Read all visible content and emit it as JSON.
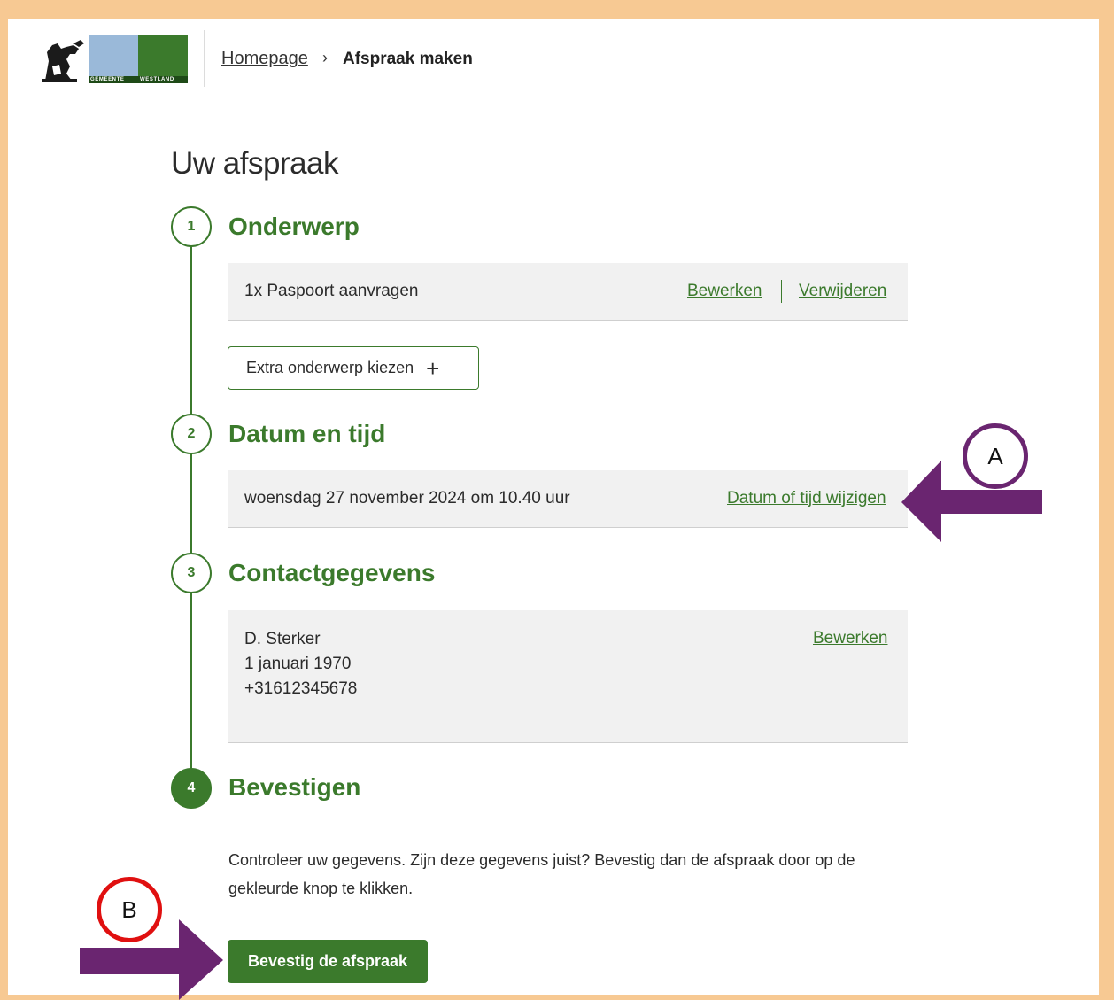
{
  "header": {
    "logo_text_left": "GEMEENTE",
    "logo_text_right": "WESTLAND",
    "breadcrumb_home": "Homepage",
    "breadcrumb_separator": "›",
    "breadcrumb_current": "Afspraak maken"
  },
  "page": {
    "title": "Uw afspraak"
  },
  "steps": [
    {
      "number": "1",
      "title": "Onderwerp"
    },
    {
      "number": "2",
      "title": "Datum en tijd"
    },
    {
      "number": "3",
      "title": "Contactgegevens"
    },
    {
      "number": "4",
      "title": "Bevestigen"
    }
  ],
  "subject": {
    "item": "1x Paspoort aanvragen",
    "edit_label": "Bewerken",
    "remove_label": "Verwijderen",
    "add_button_label": "Extra onderwerp kiezen",
    "add_icon": "+"
  },
  "datetime": {
    "value": "woensdag 27 november 2024 om 10.40 uur",
    "change_label": "Datum of tijd wijzigen"
  },
  "contact": {
    "name": "D. Sterker",
    "birthdate": "1 januari 1970",
    "phone": "+31612345678",
    "edit_label": "Bewerken"
  },
  "confirm": {
    "text": "Controleer uw gegevens. Zijn deze gegevens juist? Bevestig dan de afspraak door op de gekleurde knop te klikken.",
    "button_label": "Bevestig de afspraak"
  },
  "annotations": {
    "marker_a": "A",
    "marker_b": "B",
    "marker_a_color": "#6a2570",
    "marker_b_color": "#e01010",
    "arrow_color": "#6a2570"
  },
  "colors": {
    "brand_green": "#3b7a2c",
    "background_frame": "#f7c993",
    "panel_bg": "#f1f1f1"
  }
}
